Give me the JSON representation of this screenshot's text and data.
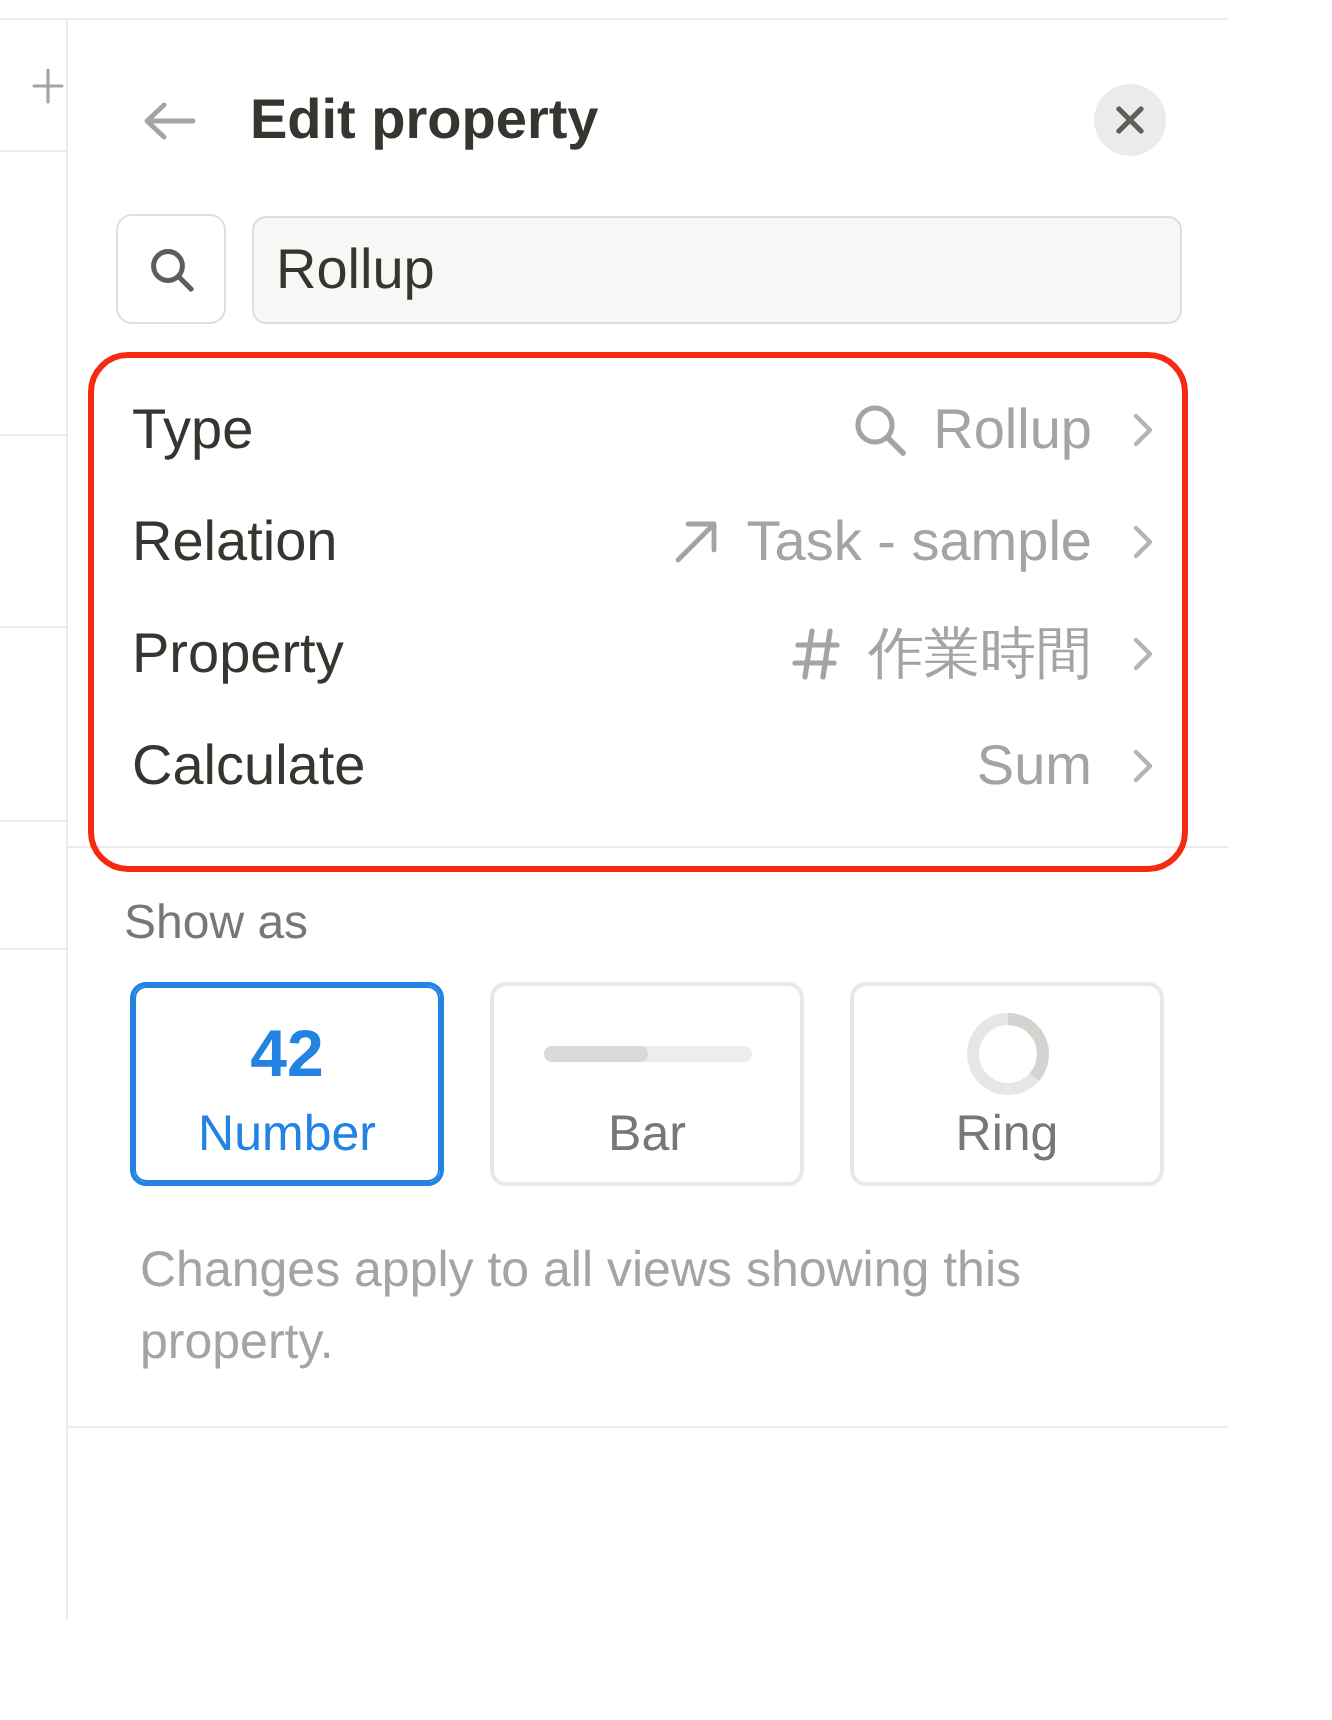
{
  "header": {
    "title": "Edit property"
  },
  "search": {
    "value": "Rollup"
  },
  "settings": {
    "highlighted": true,
    "rows": [
      {
        "kind": "type",
        "label": "Type",
        "value": "Rollup"
      },
      {
        "kind": "relation",
        "label": "Relation",
        "value": "Task - sample"
      },
      {
        "kind": "property",
        "label": "Property",
        "value": "作業時間"
      },
      {
        "kind": "calculate",
        "label": "Calculate",
        "value": "Sum"
      }
    ]
  },
  "show_as": {
    "label": "Show as",
    "options": [
      {
        "kind": "number",
        "preview": "42",
        "label": "Number",
        "selected": true
      },
      {
        "kind": "bar",
        "label": "Bar",
        "selected": false
      },
      {
        "kind": "ring",
        "label": "Ring",
        "selected": false
      }
    ]
  },
  "note": "Changes apply to all views showing this property."
}
